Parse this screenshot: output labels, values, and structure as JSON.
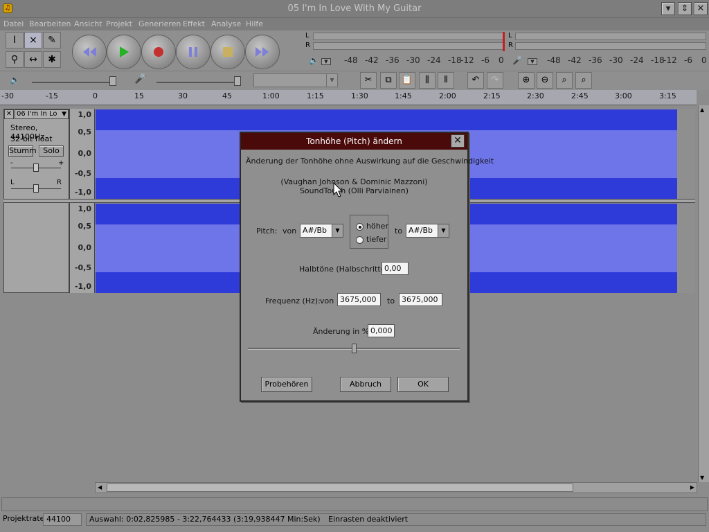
{
  "window": {
    "title": "05 I'm In Love With My Guitar",
    "controls": [
      "minimize",
      "restore",
      "close"
    ]
  },
  "menu": [
    "Datei",
    "Bearbeiten",
    "Ansicht",
    "Projekt",
    "Generieren",
    "Effekt",
    "Analyse",
    "Hilfe"
  ],
  "meters": {
    "play_lr": [
      "L",
      "R"
    ],
    "rec_lr": [
      "L",
      "R"
    ],
    "scale": [
      "-48",
      "-42",
      "-36",
      "-30",
      "-24",
      "-18",
      "-12",
      "-6",
      "0"
    ]
  },
  "ruler": {
    "ticks": [
      "-30",
      "-15",
      "0",
      "15",
      "30",
      "45",
      "1:00",
      "1:15",
      "1:30",
      "1:45",
      "2:00",
      "2:15",
      "2:30",
      "2:45",
      "3:00",
      "3:15"
    ]
  },
  "track": {
    "name": "06 I'm In Lo",
    "info_line1": "Stereo, 44100Hz",
    "info_line2": "32-bit float",
    "mute_label": "Stumm",
    "solo_label": "Solo",
    "gain_minus": "-",
    "gain_plus": "+",
    "pan_left": "L",
    "pan_right": "R",
    "scale_top": [
      "1,0",
      "0,5",
      "0,0",
      "-0,5",
      "-1,0"
    ],
    "scale_bottom": [
      "1,0",
      "0,5",
      "0,0",
      "-0,5",
      "-1,0"
    ]
  },
  "dialog": {
    "title": "Tonhöhe (Pitch) ändern",
    "description": "Änderung der Tonhöhe ohne Auswirkung auf die Geschwindigkeit",
    "credits_line1": "(Vaughan Johnson & Dominic Mazzoni)",
    "credits_line2": "SoundTouch (Olli Parviainen)",
    "pitch_label": "Pitch:",
    "from_label": "von",
    "pitch_from": "A#/Bb",
    "higher_label": "höher",
    "lower_label": "tiefer",
    "to_label": "to",
    "pitch_to": "A#/Bb",
    "semitones_label": "Halbtöne (Halbschritte):",
    "semitones_value": "0,00",
    "freq_label": "Frequenz (Hz):",
    "freq_from_label": "von",
    "freq_from_value": "3675,000",
    "freq_to_label": "to",
    "freq_to_value": "3675,000",
    "change_label": "Änderung in %:",
    "change_value": "0,000",
    "slider_level": 0.5,
    "preview_button": "Probehören",
    "cancel_button": "Abbruch",
    "ok_button": "OK"
  },
  "status": {
    "rate_label": "Projektrate:",
    "rate_value": "44100",
    "selection": "Auswahl: 0:02,825985 - 3:22,764433 (3:19,938447 Min:Sek)",
    "snap": "Einrasten deaktiviert"
  }
}
